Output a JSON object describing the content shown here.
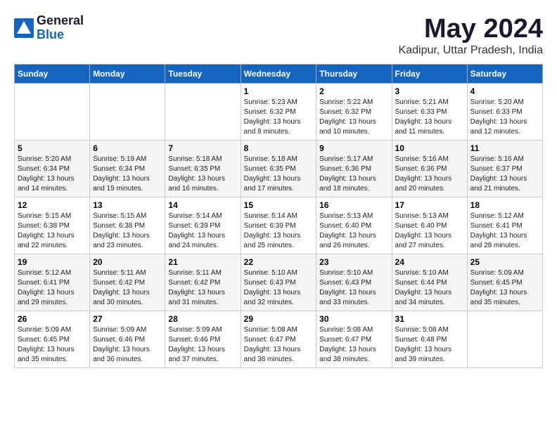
{
  "logo": {
    "general": "General",
    "blue": "Blue"
  },
  "title": "May 2024",
  "subtitle": "Kadipur, Uttar Pradesh, India",
  "weekdays": [
    "Sunday",
    "Monday",
    "Tuesday",
    "Wednesday",
    "Thursday",
    "Friday",
    "Saturday"
  ],
  "weeks": [
    [
      {
        "day": "",
        "sunrise": "",
        "sunset": "",
        "daylight": ""
      },
      {
        "day": "",
        "sunrise": "",
        "sunset": "",
        "daylight": ""
      },
      {
        "day": "",
        "sunrise": "",
        "sunset": "",
        "daylight": ""
      },
      {
        "day": "1",
        "sunrise": "Sunrise: 5:23 AM",
        "sunset": "Sunset: 6:32 PM",
        "daylight": "Daylight: 13 hours and 8 minutes."
      },
      {
        "day": "2",
        "sunrise": "Sunrise: 5:22 AM",
        "sunset": "Sunset: 6:32 PM",
        "daylight": "Daylight: 13 hours and 10 minutes."
      },
      {
        "day": "3",
        "sunrise": "Sunrise: 5:21 AM",
        "sunset": "Sunset: 6:33 PM",
        "daylight": "Daylight: 13 hours and 11 minutes."
      },
      {
        "day": "4",
        "sunrise": "Sunrise: 5:20 AM",
        "sunset": "Sunset: 6:33 PM",
        "daylight": "Daylight: 13 hours and 12 minutes."
      }
    ],
    [
      {
        "day": "5",
        "sunrise": "Sunrise: 5:20 AM",
        "sunset": "Sunset: 6:34 PM",
        "daylight": "Daylight: 13 hours and 14 minutes."
      },
      {
        "day": "6",
        "sunrise": "Sunrise: 5:19 AM",
        "sunset": "Sunset: 6:34 PM",
        "daylight": "Daylight: 13 hours and 15 minutes."
      },
      {
        "day": "7",
        "sunrise": "Sunrise: 5:18 AM",
        "sunset": "Sunset: 6:35 PM",
        "daylight": "Daylight: 13 hours and 16 minutes."
      },
      {
        "day": "8",
        "sunrise": "Sunrise: 5:18 AM",
        "sunset": "Sunset: 6:35 PM",
        "daylight": "Daylight: 13 hours and 17 minutes."
      },
      {
        "day": "9",
        "sunrise": "Sunrise: 5:17 AM",
        "sunset": "Sunset: 6:36 PM",
        "daylight": "Daylight: 13 hours and 18 minutes."
      },
      {
        "day": "10",
        "sunrise": "Sunrise: 5:16 AM",
        "sunset": "Sunset: 6:36 PM",
        "daylight": "Daylight: 13 hours and 20 minutes."
      },
      {
        "day": "11",
        "sunrise": "Sunrise: 5:16 AM",
        "sunset": "Sunset: 6:37 PM",
        "daylight": "Daylight: 13 hours and 21 minutes."
      }
    ],
    [
      {
        "day": "12",
        "sunrise": "Sunrise: 5:15 AM",
        "sunset": "Sunset: 6:38 PM",
        "daylight": "Daylight: 13 hours and 22 minutes."
      },
      {
        "day": "13",
        "sunrise": "Sunrise: 5:15 AM",
        "sunset": "Sunset: 6:38 PM",
        "daylight": "Daylight: 13 hours and 23 minutes."
      },
      {
        "day": "14",
        "sunrise": "Sunrise: 5:14 AM",
        "sunset": "Sunset: 6:39 PM",
        "daylight": "Daylight: 13 hours and 24 minutes."
      },
      {
        "day": "15",
        "sunrise": "Sunrise: 5:14 AM",
        "sunset": "Sunset: 6:39 PM",
        "daylight": "Daylight: 13 hours and 25 minutes."
      },
      {
        "day": "16",
        "sunrise": "Sunrise: 5:13 AM",
        "sunset": "Sunset: 6:40 PM",
        "daylight": "Daylight: 13 hours and 26 minutes."
      },
      {
        "day": "17",
        "sunrise": "Sunrise: 5:13 AM",
        "sunset": "Sunset: 6:40 PM",
        "daylight": "Daylight: 13 hours and 27 minutes."
      },
      {
        "day": "18",
        "sunrise": "Sunrise: 5:12 AM",
        "sunset": "Sunset: 6:41 PM",
        "daylight": "Daylight: 13 hours and 28 minutes."
      }
    ],
    [
      {
        "day": "19",
        "sunrise": "Sunrise: 5:12 AM",
        "sunset": "Sunset: 6:41 PM",
        "daylight": "Daylight: 13 hours and 29 minutes."
      },
      {
        "day": "20",
        "sunrise": "Sunrise: 5:11 AM",
        "sunset": "Sunset: 6:42 PM",
        "daylight": "Daylight: 13 hours and 30 minutes."
      },
      {
        "day": "21",
        "sunrise": "Sunrise: 5:11 AM",
        "sunset": "Sunset: 6:42 PM",
        "daylight": "Daylight: 13 hours and 31 minutes."
      },
      {
        "day": "22",
        "sunrise": "Sunrise: 5:10 AM",
        "sunset": "Sunset: 6:43 PM",
        "daylight": "Daylight: 13 hours and 32 minutes."
      },
      {
        "day": "23",
        "sunrise": "Sunrise: 5:10 AM",
        "sunset": "Sunset: 6:43 PM",
        "daylight": "Daylight: 13 hours and 33 minutes."
      },
      {
        "day": "24",
        "sunrise": "Sunrise: 5:10 AM",
        "sunset": "Sunset: 6:44 PM",
        "daylight": "Daylight: 13 hours and 34 minutes."
      },
      {
        "day": "25",
        "sunrise": "Sunrise: 5:09 AM",
        "sunset": "Sunset: 6:45 PM",
        "daylight": "Daylight: 13 hours and 35 minutes."
      }
    ],
    [
      {
        "day": "26",
        "sunrise": "Sunrise: 5:09 AM",
        "sunset": "Sunset: 6:45 PM",
        "daylight": "Daylight: 13 hours and 35 minutes."
      },
      {
        "day": "27",
        "sunrise": "Sunrise: 5:09 AM",
        "sunset": "Sunset: 6:46 PM",
        "daylight": "Daylight: 13 hours and 36 minutes."
      },
      {
        "day": "28",
        "sunrise": "Sunrise: 5:09 AM",
        "sunset": "Sunset: 6:46 PM",
        "daylight": "Daylight: 13 hours and 37 minutes."
      },
      {
        "day": "29",
        "sunrise": "Sunrise: 5:08 AM",
        "sunset": "Sunset: 6:47 PM",
        "daylight": "Daylight: 13 hours and 38 minutes."
      },
      {
        "day": "30",
        "sunrise": "Sunrise: 5:08 AM",
        "sunset": "Sunset: 6:47 PM",
        "daylight": "Daylight: 13 hours and 38 minutes."
      },
      {
        "day": "31",
        "sunrise": "Sunrise: 5:08 AM",
        "sunset": "Sunset: 6:48 PM",
        "daylight": "Daylight: 13 hours and 39 minutes."
      },
      {
        "day": "",
        "sunrise": "",
        "sunset": "",
        "daylight": ""
      }
    ]
  ]
}
